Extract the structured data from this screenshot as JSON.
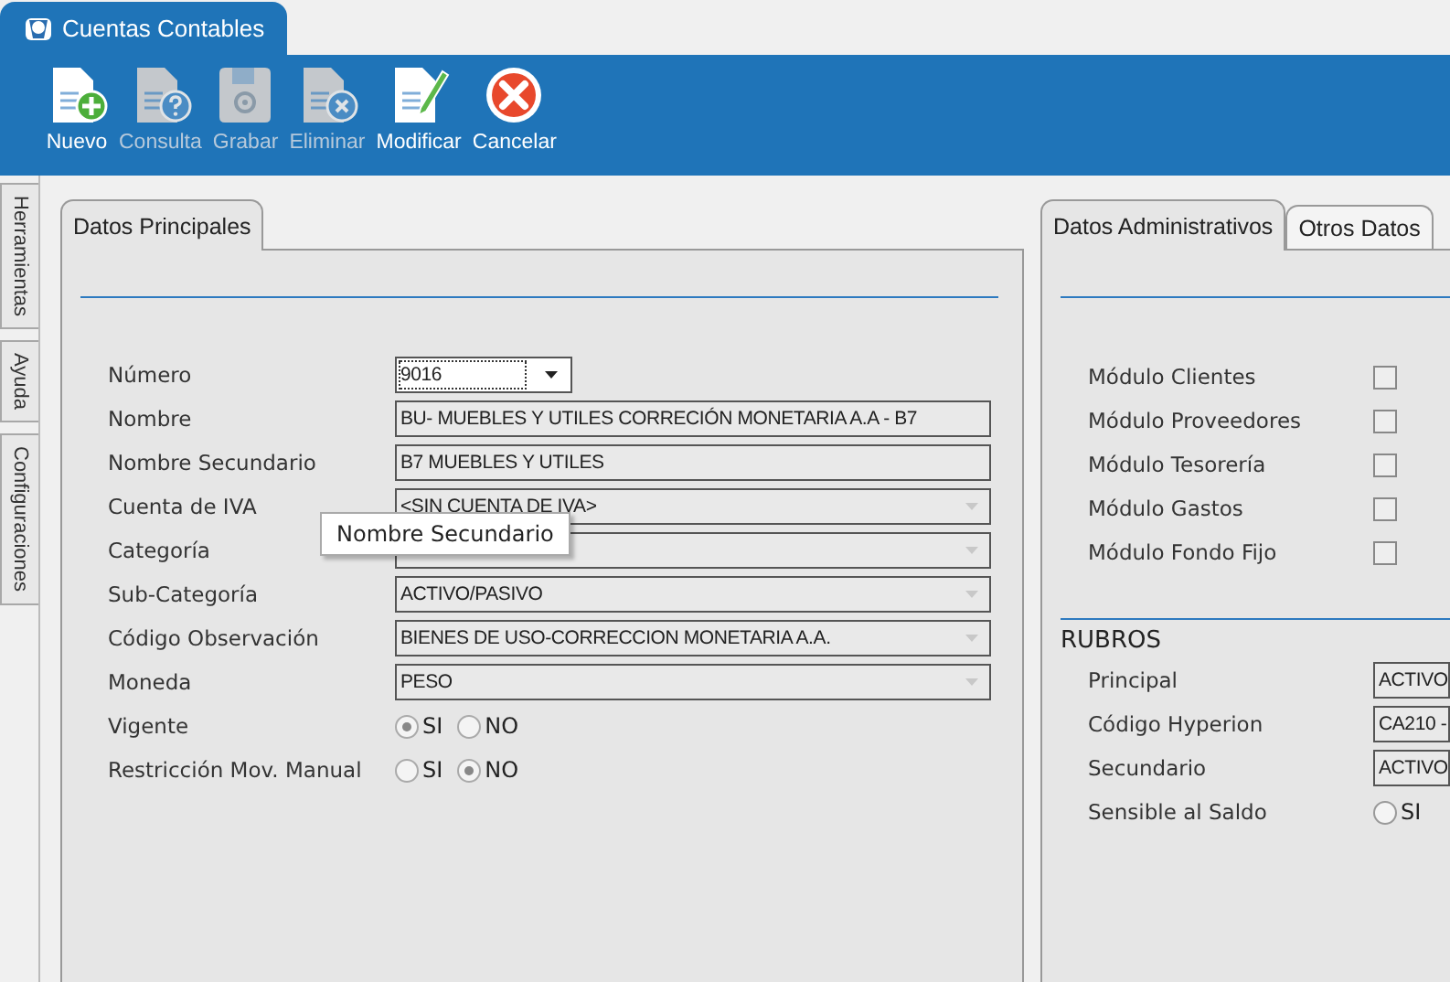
{
  "window": {
    "title": "Cuentas Contables"
  },
  "toolbar": [
    {
      "kind": "new",
      "label": "Nuevo",
      "disabled": false
    },
    {
      "kind": "query",
      "label": "Consulta",
      "disabled": true
    },
    {
      "kind": "save",
      "label": "Grabar",
      "disabled": true
    },
    {
      "kind": "delete",
      "label": "Eliminar",
      "disabled": true
    },
    {
      "kind": "edit",
      "label": "Modificar",
      "disabled": false
    },
    {
      "kind": "cancel",
      "label": "Cancelar",
      "disabled": false
    }
  ],
  "side_tabs": [
    "Herramientas",
    "Ayuda",
    "Configuraciones"
  ],
  "main_panel": {
    "tabs": [
      {
        "label": "Datos Principales",
        "selected": true
      }
    ],
    "fields": [
      {
        "label": "Número",
        "kind": "combo",
        "value": "9016",
        "disabled": false
      },
      {
        "label": "Nombre",
        "kind": "text",
        "value": "BU- MUEBLES Y UTILES CORRECIÓN MONETARIA A.A - B7"
      },
      {
        "label": "Nombre Secundario",
        "kind": "text",
        "value": "B7 MUEBLES Y UTILES"
      },
      {
        "label": "Cuenta de IVA",
        "kind": "combo",
        "value": "<SIN CUENTA DE IVA>",
        "disabled": true
      },
      {
        "label": "Categoría",
        "kind": "combo",
        "disabled": true
      },
      {
        "label": "Sub-Categoría",
        "kind": "combo",
        "value": "ACTIVO/PASIVO",
        "disabled": true
      },
      {
        "label": "Código Observación",
        "kind": "combo",
        "value": "BIENES DE USO-CORRECCION MONETARIA A.A.",
        "disabled": true
      },
      {
        "label": "Moneda",
        "kind": "combo",
        "value": "PESO",
        "disabled": true
      },
      {
        "label": "Vigente",
        "kind": "radio",
        "disabled": true,
        "options": [
          {
            "label": "SI",
            "selected": true
          },
          {
            "label": "NO",
            "selected": false
          }
        ]
      },
      {
        "label": "Restricción Mov. Manual",
        "kind": "radio",
        "disabled": true,
        "options": [
          {
            "label": "SI",
            "selected": false
          },
          {
            "label": "NO",
            "selected": true
          }
        ]
      }
    ],
    "tooltip": "Nombre Secundario"
  },
  "admin_panel": {
    "tabs": [
      {
        "label": "Datos Administrativos",
        "selected": true
      },
      {
        "label": "Otros Datos",
        "selected": false
      }
    ],
    "modules": [
      {
        "label": "Módulo Clientes",
        "checked": false
      },
      {
        "label": "Módulo Proveedores",
        "checked": false
      },
      {
        "label": "Módulo Tesorería",
        "checked": false
      },
      {
        "label": "Módulo Gastos",
        "checked": false
      },
      {
        "label": "Módulo Fondo Fijo",
        "checked": false
      }
    ],
    "section_title": "RUBROS",
    "fields": [
      {
        "label": "Principal",
        "kind": "text",
        "value": "ACTIVO"
      },
      {
        "label": "Código Hyperion",
        "kind": "text",
        "value": "CA210 -"
      },
      {
        "label": "Secundario",
        "kind": "text",
        "value": "ACTIVO"
      },
      {
        "label": "Sensible al Saldo",
        "kind": "radio",
        "disabled": false,
        "options": [
          {
            "label": "SI",
            "selected": false
          }
        ]
      }
    ]
  }
}
